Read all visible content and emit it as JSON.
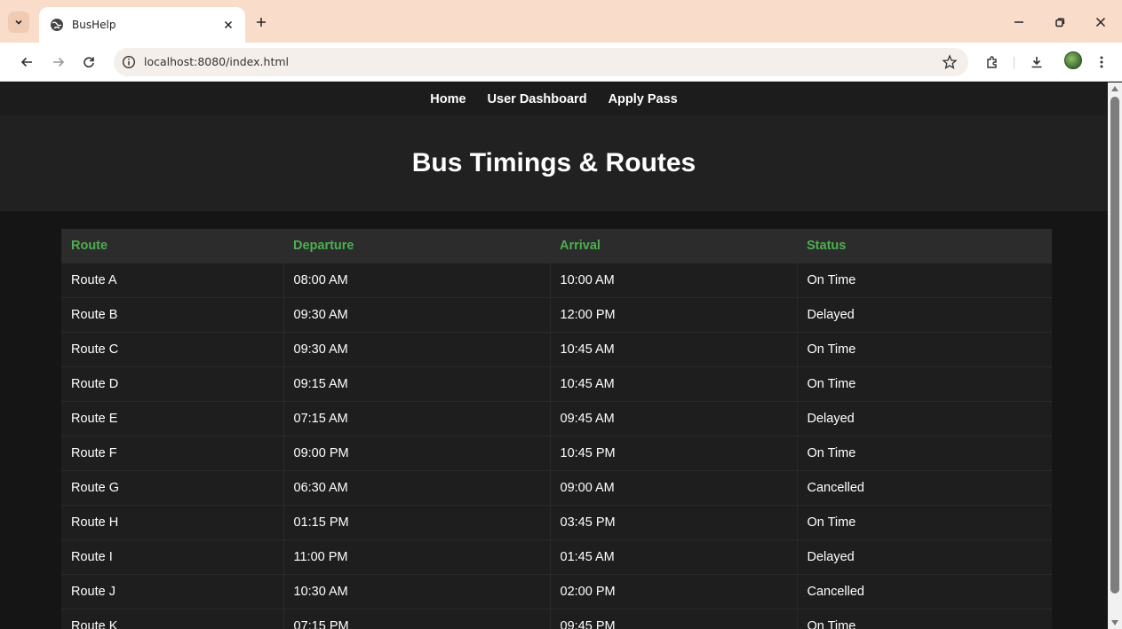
{
  "browser": {
    "tab_title": "BusHelp",
    "url": "localhost:8080/index.html"
  },
  "nav": {
    "home": "Home",
    "dashboard": "User Dashboard",
    "apply": "Apply Pass"
  },
  "hero": {
    "title": "Bus Timings & Routes"
  },
  "table": {
    "headers": [
      "Route",
      "Departure",
      "Arrival",
      "Status"
    ],
    "rows": [
      [
        "Route A",
        "08:00 AM",
        "10:00 AM",
        "On Time"
      ],
      [
        "Route B",
        "09:30 AM",
        "12:00 PM",
        "Delayed"
      ],
      [
        "Route C",
        "09:30 AM",
        "10:45 AM",
        "On Time"
      ],
      [
        "Route D",
        "09:15 AM",
        "10:45 AM",
        "On Time"
      ],
      [
        "Route E",
        "07:15 AM",
        "09:45 AM",
        "Delayed"
      ],
      [
        "Route F",
        "09:00 PM",
        "10:45 PM",
        "On Time"
      ],
      [
        "Route G",
        "06:30 AM",
        "09:00 AM",
        "Cancelled"
      ],
      [
        "Route H",
        "01:15 PM",
        "03:45 PM",
        "On Time"
      ],
      [
        "Route I",
        "11:00 PM",
        "01:45 AM",
        "Delayed"
      ],
      [
        "Route J",
        "10:30 AM",
        "02:00 PM",
        "Cancelled"
      ],
      [
        "Route K",
        "07:15 PM",
        "09:45 PM",
        "On Time"
      ]
    ]
  },
  "colors": {
    "header_text": "#4caf50",
    "page_bg": "#151515",
    "tab_strip": "#f9dcc9"
  }
}
